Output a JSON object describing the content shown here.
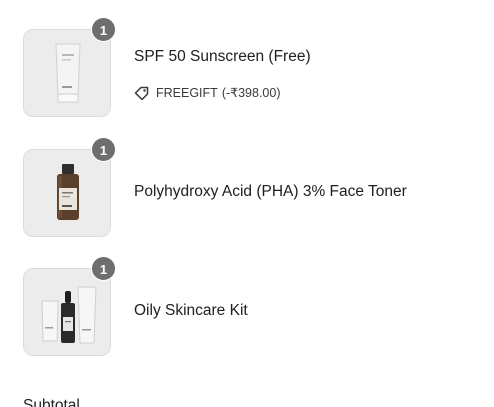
{
  "cart": {
    "items": [
      {
        "title": "SPF 50 Sunscreen (Free)",
        "quantity": "1",
        "discount_code": "FREEGIFT",
        "discount_amount": "(-₹398.00)"
      },
      {
        "title": "Polyhydroxy Acid (PHA) 3% Face Toner",
        "quantity": "1"
      },
      {
        "title": "Oily Skincare Kit",
        "quantity": "1"
      }
    ],
    "subtotal_label": "Subtotal"
  },
  "icons": {
    "discount": "tag-icon"
  }
}
